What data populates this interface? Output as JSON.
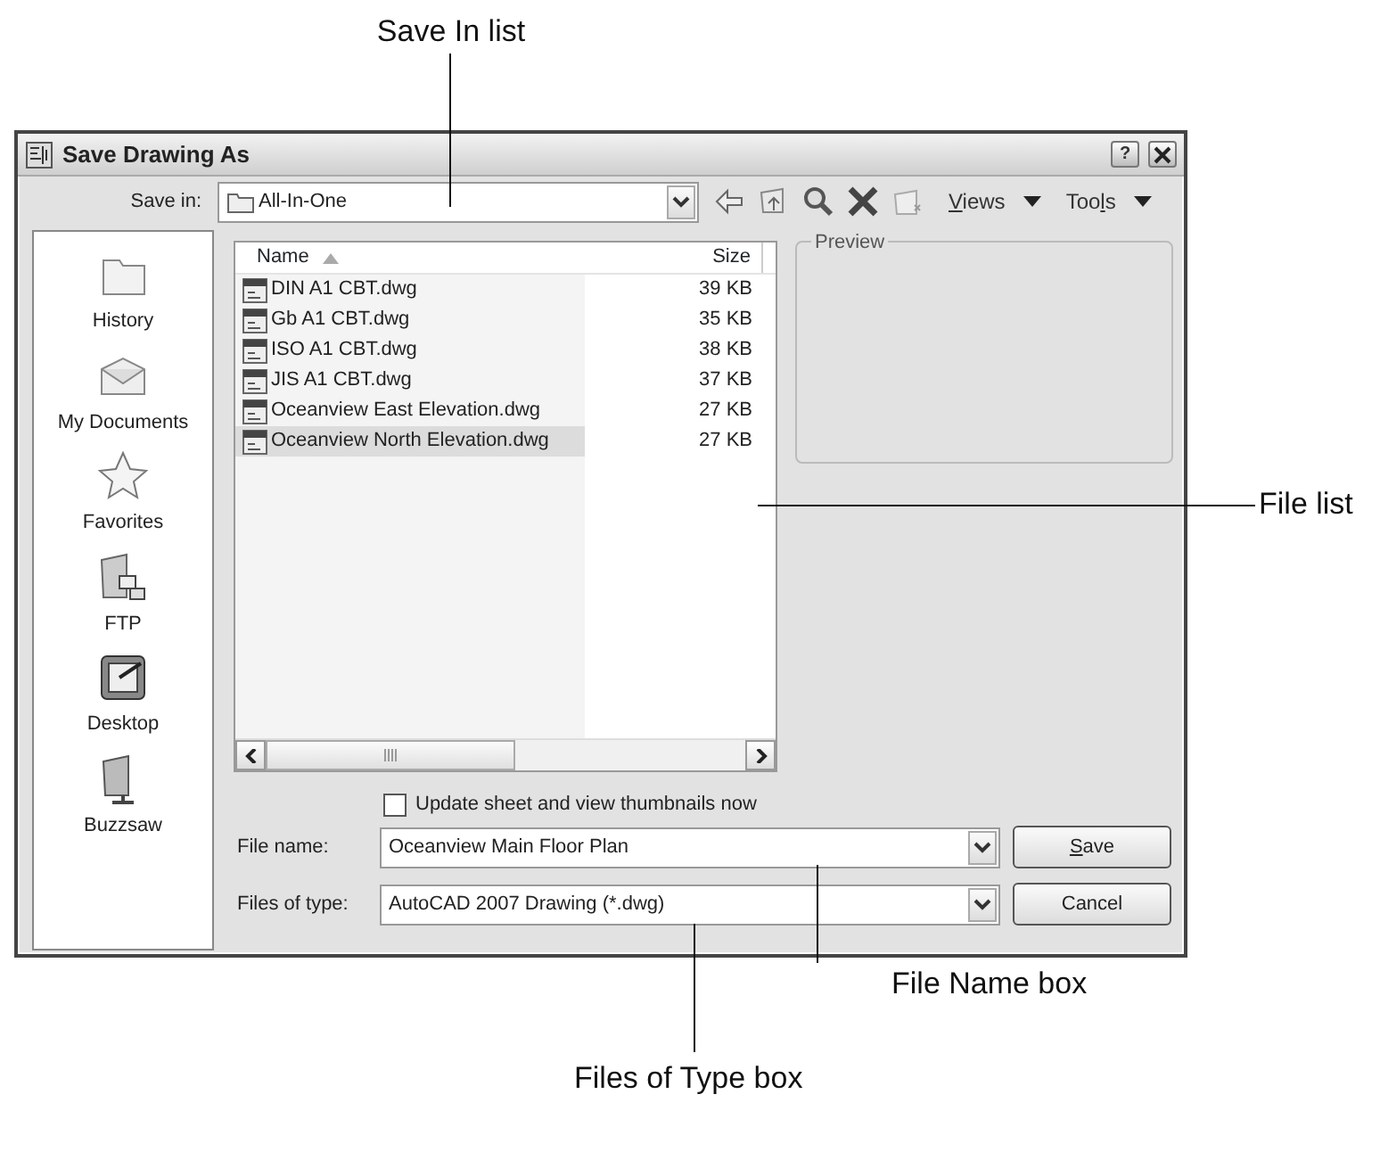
{
  "callouts": [
    {
      "label": "Save In list"
    },
    {
      "label": "File list"
    },
    {
      "label": "File Name box"
    },
    {
      "label": "Files of Type box"
    }
  ],
  "window": {
    "title": "Save Drawing As",
    "buttons": [
      "?"
    ]
  },
  "save_in": {
    "label": "Save in:",
    "value": "All-In-One"
  },
  "toolbar": {
    "menus": [
      {
        "label_parts": [
          {
            "text": "V",
            "underlined": true
          },
          {
            "text": "iews",
            "underlined": false
          }
        ]
      },
      {
        "label_parts": [
          {
            "text": "Too",
            "underlined": false
          },
          {
            "text": "l",
            "underlined": true
          },
          {
            "text": "s",
            "underlined": false
          }
        ]
      }
    ]
  },
  "places": [
    {
      "label": "History"
    },
    {
      "label": "My Documents"
    },
    {
      "label": "Favorites"
    },
    {
      "label": "FTP"
    },
    {
      "label": "Desktop"
    },
    {
      "label": "Buzzsaw"
    }
  ],
  "file_list": {
    "columns": [
      "Name",
      "Size"
    ],
    "rows": [
      {
        "name": "DIN A1 CBT.dwg",
        "size": "39 KB",
        "selected": false
      },
      {
        "name": "Gb A1 CBT.dwg",
        "size": "35 KB",
        "selected": false
      },
      {
        "name": "ISO A1 CBT.dwg",
        "size": "38 KB",
        "selected": false
      },
      {
        "name": "JIS A1 CBT.dwg",
        "size": "37 KB",
        "selected": false
      },
      {
        "name": "Oceanview East Elevation.dwg",
        "size": "27 KB",
        "selected": false
      },
      {
        "name": "Oceanview North Elevation.dwg",
        "size": "27 KB",
        "selected": true
      }
    ]
  },
  "preview": {
    "label": "Preview"
  },
  "update_thumbnails": {
    "label": "Update sheet and view thumbnails now",
    "checked": false
  },
  "file_name": {
    "label": "File name:",
    "value": "Oceanview Main Floor Plan"
  },
  "file_type": {
    "label": "Files of type:",
    "value": "AutoCAD 2007 Drawing (*.dwg)"
  },
  "buttons": [
    {
      "label_parts": [
        {
          "text": "S",
          "underlined": true
        },
        {
          "text": "ave",
          "underlined": false
        }
      ]
    },
    {
      "label_parts": [
        {
          "text": "Cancel",
          "underlined": false
        }
      ]
    }
  ]
}
